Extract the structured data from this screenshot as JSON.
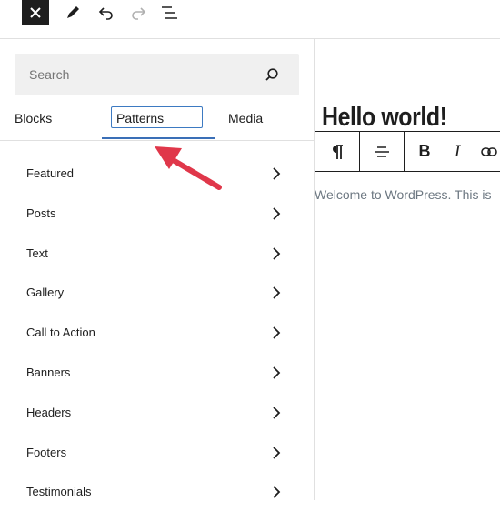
{
  "toolbar": {
    "close_icon": "close-icon",
    "edit_icon": "pencil-icon",
    "undo_icon": "undo-icon",
    "redo_icon": "redo-icon",
    "outline_icon": "list-view-icon"
  },
  "inserter": {
    "search": {
      "placeholder": "Search",
      "icon": "search-icon"
    },
    "tabs": [
      {
        "label": "Blocks"
      },
      {
        "label": "Patterns",
        "active": true
      },
      {
        "label": "Media"
      }
    ],
    "categories": [
      "Featured",
      "Posts",
      "Text",
      "Gallery",
      "Call to Action",
      "Banners",
      "Headers",
      "Footers",
      "Testimonials"
    ]
  },
  "editor": {
    "title": "Hello world!",
    "paragraph": "Welcome to WordPress. This is",
    "format_toolbar": [
      "paragraph-icon",
      "align-icon",
      "B",
      "I",
      "link-icon"
    ]
  },
  "colors": {
    "accent": "#3a6fb7",
    "arrow": "#e0374a"
  }
}
